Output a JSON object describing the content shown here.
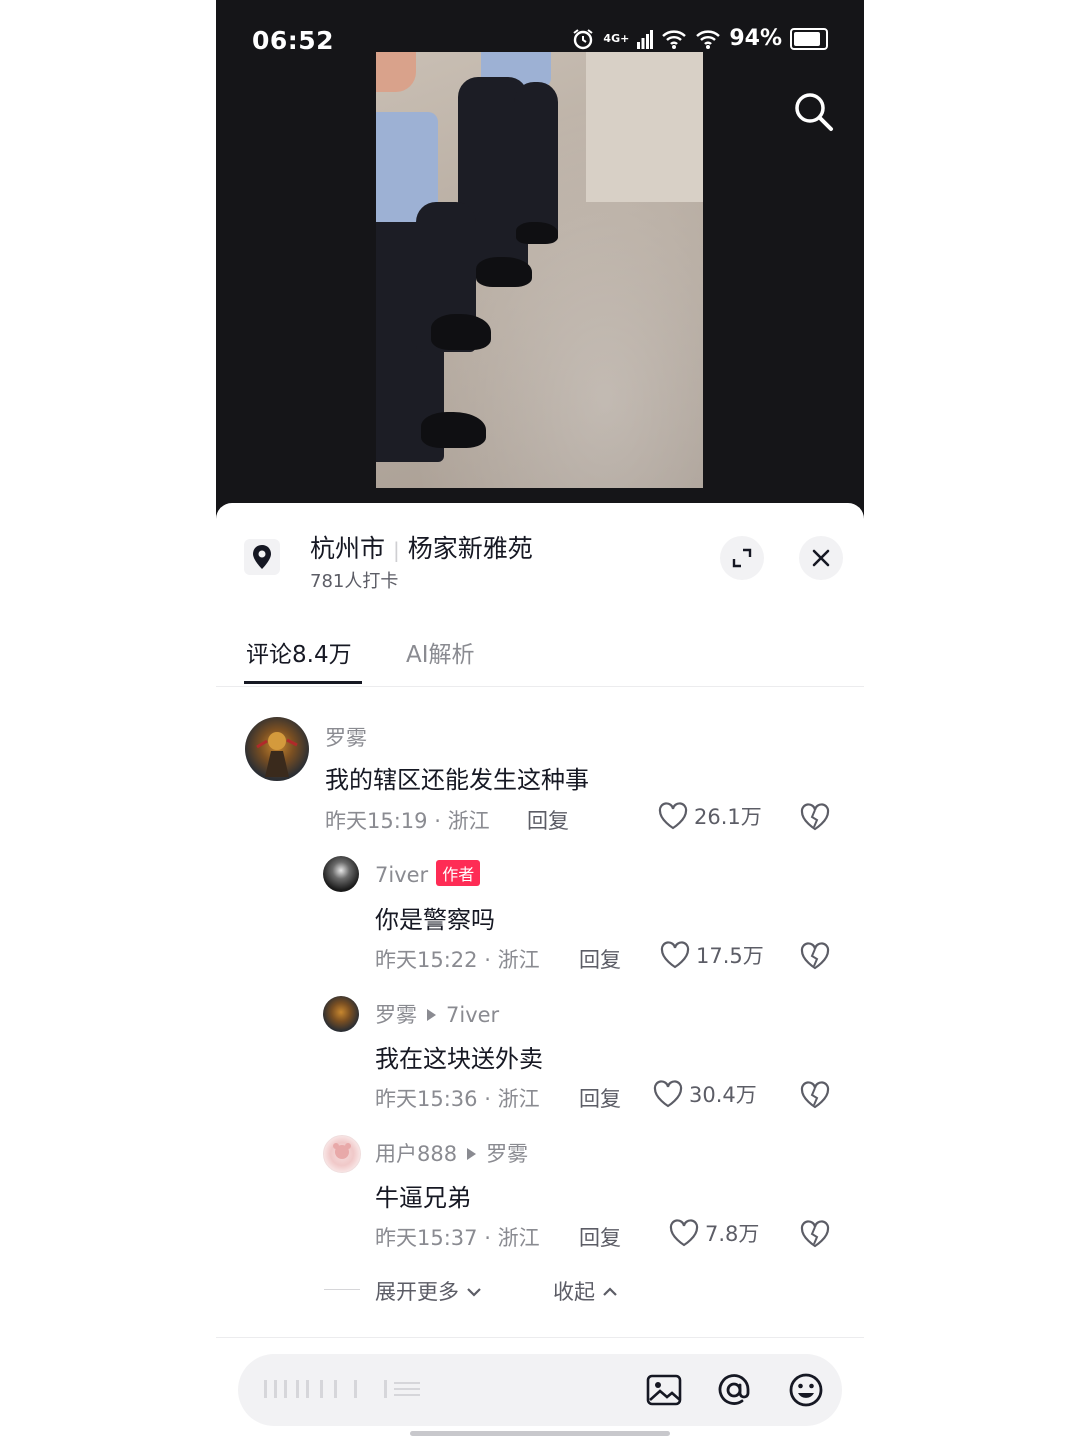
{
  "status_bar": {
    "time": "06:52",
    "network": "4G+",
    "battery": "94%"
  },
  "location": {
    "city": "杭州市",
    "place": "杨家新雅苑",
    "checkins": "781人打卡"
  },
  "tabs": [
    {
      "label": "评论8.4万",
      "active": true
    },
    {
      "label": "AI解析",
      "active": false
    }
  ],
  "comments": [
    {
      "user": "罗雾",
      "text": "我的辖区还能发生这种事",
      "time": "昨天15:19",
      "region": "浙江",
      "reply_label": "回复",
      "likes": "26.1万"
    },
    {
      "user": "7iver",
      "badge": "作者",
      "text": "你是警察吗",
      "time": "昨天15:22",
      "region": "浙江",
      "reply_label": "回复",
      "likes": "17.5万"
    },
    {
      "user": "罗雾",
      "reply_to": "7iver",
      "text": "我在这块送外卖",
      "time": "昨天15:36",
      "region": "浙江",
      "reply_label": "回复",
      "likes": "30.4万"
    },
    {
      "user": "用户888",
      "reply_to": "罗雾",
      "text": "牛逼兄弟",
      "time": "昨天15:37",
      "region": "浙江",
      "reply_label": "回复",
      "likes": "7.8万"
    }
  ],
  "expand_more": "展开更多",
  "collapse": "收起",
  "separator": "·",
  "icons": {
    "search": "search-icon",
    "location": "location-pin-icon",
    "expand": "expand-icon",
    "close": "close-icon",
    "like": "heart-icon",
    "dislike": "broken-heart-icon",
    "image": "image-icon",
    "mention": "at-icon",
    "emoji": "emoji-icon"
  },
  "colors": {
    "accent": "#fe2c55",
    "text": "#161823",
    "muted": "#8a8b91",
    "video_bg": "#151518"
  }
}
